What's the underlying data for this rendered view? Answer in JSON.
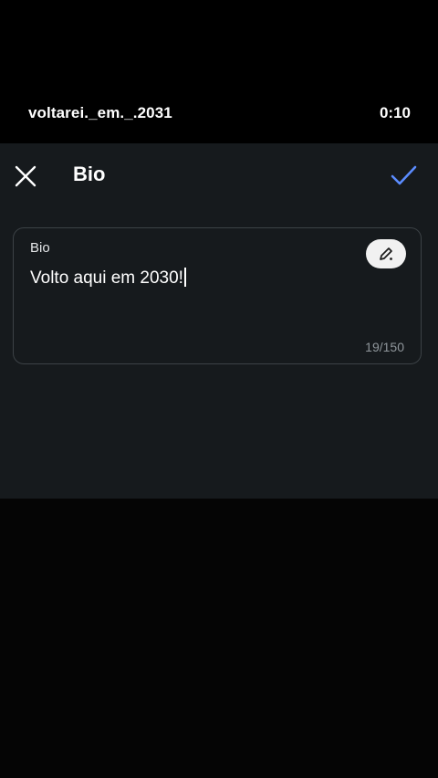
{
  "video": {
    "account_name": "voltarei._em._.2031",
    "timer": "0:10"
  },
  "bio_editor": {
    "title": "Bio",
    "close_icon": "close-icon",
    "confirm_icon": "checkmark-icon",
    "confirm_color": "#5b8cff",
    "field_label": "Bio",
    "field_value": "Volto aqui em 2030!",
    "edit_icon": "pencil-icon",
    "char_count": "19/150"
  }
}
